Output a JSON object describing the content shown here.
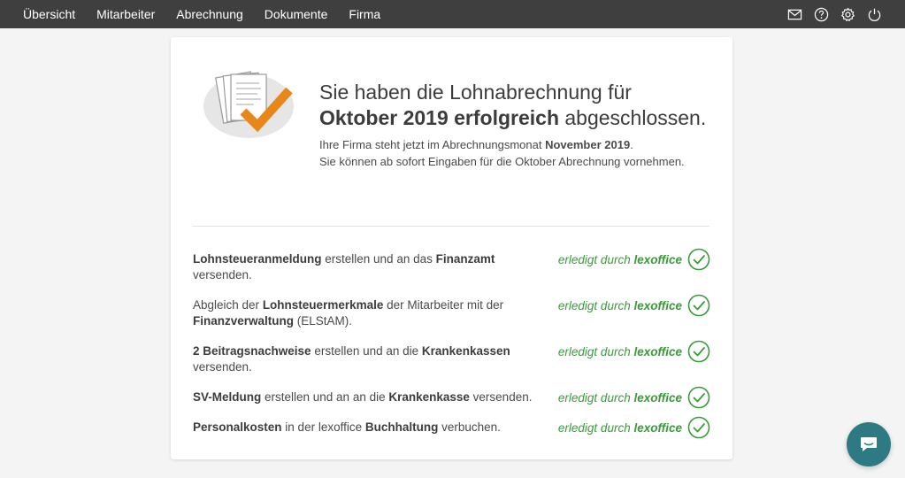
{
  "nav": {
    "items": [
      {
        "label": "Übersicht"
      },
      {
        "label": "Mitarbeiter"
      },
      {
        "label": "Abrechnung"
      },
      {
        "label": "Dokumente"
      },
      {
        "label": "Firma"
      }
    ],
    "icons": [
      "mail-icon",
      "help-icon",
      "settings-icon",
      "power-icon"
    ]
  },
  "success": {
    "headline_line1": "Sie haben die Lohnabrechnung für",
    "headline_month": "Oktober 2019 erfolgreich",
    "headline_rest": "abgeschlossen.",
    "sub_line1_prefix": "Ihre Firma steht jetzt im Abrechnungsmonat",
    "sub_line1_month": "November 2019",
    "sub_line1_suffix": ".",
    "sub_line2": "Sie können ab sofort Eingaben für die Oktober Abrechnung vornehmen."
  },
  "status": {
    "prefix": "erledigt durch",
    "brand": "lexoffice"
  },
  "tasks": [
    {
      "parts": [
        {
          "b": "Lohnsteueranmeldung"
        },
        {
          "t": " erstellen und an das "
        },
        {
          "b": "Finanzamt"
        },
        {
          "t": " versenden."
        }
      ]
    },
    {
      "parts": [
        {
          "t": "Abgleich der "
        },
        {
          "b": "Lohnsteuermerkmale"
        },
        {
          "t": " der Mitarbeiter mit der "
        },
        {
          "b": "Finanzverwaltung"
        },
        {
          "t": " (ELStAM)."
        }
      ]
    },
    {
      "parts": [
        {
          "b": "2 Beitragsnachweise"
        },
        {
          "t": " erstellen und an die "
        },
        {
          "b": "Krankenkassen"
        },
        {
          "t": " versenden."
        }
      ]
    },
    {
      "parts": [
        {
          "b": "SV-Meldung"
        },
        {
          "t": " erstellen und an an die "
        },
        {
          "b": "Krankenkasse"
        },
        {
          "t": " versenden."
        }
      ]
    },
    {
      "parts": [
        {
          "b": "Personalkosten"
        },
        {
          "t": " in der lexoffice "
        },
        {
          "b": "Buchhaltung"
        },
        {
          "t": " verbuchen."
        }
      ]
    }
  ],
  "colors": {
    "topbar": "#3f3f3f",
    "success_green": "#3a9b3a",
    "check_orange": "#e8861a",
    "chat_teal": "#2d7a82"
  },
  "chat": {
    "icon": "chat-icon"
  }
}
